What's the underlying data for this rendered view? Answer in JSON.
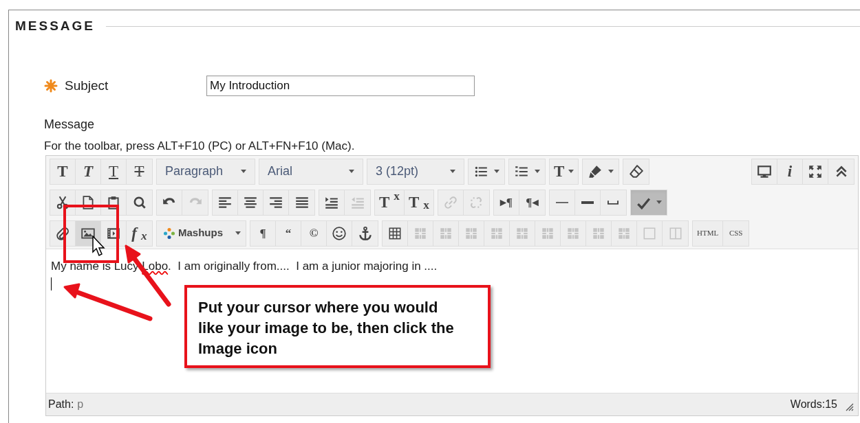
{
  "section": {
    "title": "MESSAGE"
  },
  "subject": {
    "label": "Subject",
    "required": true,
    "value": "My Introduction"
  },
  "message": {
    "label": "Message",
    "hint": "For the toolbar, press ALT+F10 (PC) or ALT+FN+F10 (Mac)."
  },
  "toolbar": {
    "rows": [
      {
        "groups": [
          {
            "buttons": [
              {
                "kind": "bold",
                "label": "T",
                "disabled": false,
                "pressed": false,
                "hovered": false
              },
              {
                "kind": "italic",
                "label": "T",
                "disabled": false,
                "pressed": false,
                "hovered": false
              },
              {
                "kind": "underline",
                "label": "T",
                "disabled": false,
                "pressed": false,
                "hovered": false
              },
              {
                "kind": "strike",
                "label": "T",
                "disabled": false,
                "pressed": false,
                "hovered": false
              }
            ]
          },
          {
            "buttons": [
              {
                "kind": "select",
                "label": "Paragraph",
                "disabled": false,
                "pressed": false,
                "hovered": false
              }
            ]
          },
          {
            "buttons": [
              {
                "kind": "select",
                "label": "Arial",
                "disabled": false,
                "pressed": false,
                "hovered": false
              }
            ]
          },
          {
            "buttons": [
              {
                "kind": "select",
                "label": "3 (12pt)",
                "disabled": false,
                "pressed": false,
                "hovered": false
              }
            ]
          },
          {
            "buttons": [
              {
                "kind": "split",
                "disabled": false,
                "pressed": false,
                "hovered": false
              }
            ]
          },
          {
            "buttons": [
              {
                "kind": "split",
                "disabled": false,
                "pressed": false,
                "hovered": false
              }
            ]
          },
          {
            "buttons": [
              {
                "kind": "splitglyph",
                "label": "T",
                "disabled": false,
                "pressed": false,
                "hovered": false
              }
            ]
          },
          {
            "buttons": [
              {
                "kind": "split",
                "disabled": false,
                "pressed": false,
                "hovered": false
              }
            ]
          },
          {
            "buttons": [
              {
                "kind": "icon",
                "disabled": false,
                "pressed": false,
                "hovered": false
              }
            ]
          }
        ],
        "right_groups": [
          {
            "buttons": [
              {
                "kind": "icon",
                "disabled": false,
                "pressed": false,
                "hovered": false
              },
              {
                "kind": "italic",
                "label": "i",
                "disabled": false,
                "pressed": false,
                "hovered": false
              },
              {
                "kind": "icon",
                "disabled": false,
                "pressed": false,
                "hovered": false
              },
              {
                "kind": "icon",
                "disabled": false,
                "pressed": false,
                "hovered": false
              }
            ]
          }
        ]
      },
      {
        "groups": [
          {
            "buttons": [
              {
                "kind": "icon",
                "disabled": false,
                "pressed": false,
                "hovered": false
              },
              {
                "kind": "icon",
                "disabled": false,
                "pressed": false,
                "hovered": false
              },
              {
                "kind": "icon",
                "disabled": false,
                "pressed": false,
                "hovered": false
              },
              {
                "kind": "icon",
                "disabled": false,
                "pressed": false,
                "hovered": false
              }
            ]
          },
          {
            "buttons": [
              {
                "kind": "icon",
                "disabled": false,
                "pressed": false,
                "hovered": false
              },
              {
                "kind": "icon",
                "disabled": true,
                "pressed": false,
                "hovered": false
              }
            ]
          },
          {
            "buttons": [
              {
                "kind": "icon",
                "disabled": false,
                "pressed": false,
                "hovered": false
              },
              {
                "kind": "icon",
                "disabled": false,
                "pressed": false,
                "hovered": false
              },
              {
                "kind": "icon",
                "disabled": false,
                "pressed": false,
                "hovered": false
              },
              {
                "kind": "icon",
                "disabled": false,
                "pressed": false,
                "hovered": false
              }
            ]
          },
          {
            "buttons": [
              {
                "kind": "icon",
                "disabled": false,
                "pressed": false,
                "hovered": false
              },
              {
                "kind": "icon",
                "disabled": true,
                "pressed": false,
                "hovered": false
              }
            ]
          },
          {
            "buttons": [
              {
                "kind": "bold",
                "label": "T$^{x}$",
                "disabled": false,
                "pressed": false,
                "hovered": false
              },
              {
                "kind": "bold",
                "label": "T$_{x}$",
                "disabled": false,
                "pressed": false,
                "hovered": false
              }
            ]
          },
          {
            "buttons": [
              {
                "kind": "icon",
                "disabled": true,
                "pressed": false,
                "hovered": false
              },
              {
                "kind": "icon",
                "disabled": true,
                "pressed": false,
                "hovered": false
              }
            ]
          },
          {
            "buttons": [
              {
                "kind": "small",
                "label": "▸¶",
                "disabled": false,
                "pressed": false,
                "hovered": false
              },
              {
                "kind": "small",
                "label": "¶◂",
                "disabled": false,
                "pressed": false,
                "hovered": false
              }
            ]
          },
          {
            "buttons": [
              {
                "kind": "icon",
                "disabled": false,
                "pressed": false,
                "hovered": false
              },
              {
                "kind": "icon",
                "disabled": false,
                "pressed": false,
                "hovered": false
              },
              {
                "kind": "icon",
                "disabled": false,
                "pressed": false,
                "hovered": false
              }
            ]
          },
          {
            "buttons": [
              {
                "kind": "split",
                "disabled": false,
                "pressed": true,
                "hovered": false
              }
            ]
          }
        ]
      },
      {
        "groups": [
          {
            "buttons": [
              {
                "kind": "icon",
                "disabled": false,
                "pressed": false,
                "hovered": false
              },
              {
                "kind": "icon",
                "disabled": false,
                "pressed": false,
                "hovered": true
              },
              {
                "kind": "icon",
                "disabled": false,
                "pressed": false,
                "hovered": false
              },
              {
                "kind": "italic",
                "label": "f$_{x}$",
                "disabled": false,
                "pressed": false,
                "hovered": false
              }
            ]
          },
          {
            "buttons": [
              {
                "kind": "menu",
                "label": "Mashups",
                "disabled": false,
                "pressed": false,
                "hovered": false
              }
            ]
          },
          {
            "buttons": [
              {
                "kind": "small",
                "label": "¶",
                "disabled": false,
                "pressed": false,
                "hovered": false
              },
              {
                "kind": "small",
                "label": "“",
                "disabled": false,
                "pressed": false,
                "hovered": false
              },
              {
                "kind": "small",
                "label": "©",
                "disabled": false,
                "pressed": false,
                "hovered": false
              },
              {
                "kind": "icon",
                "disabled": false,
                "pressed": false,
                "hovered": false
              },
              {
                "kind": "icon",
                "disabled": false,
                "pressed": false,
                "hovered": false
              }
            ]
          },
          {
            "buttons": [
              {
                "kind": "icon",
                "disabled": false,
                "pressed": false,
                "hovered": false
              },
              {
                "kind": "icon",
                "disabled": true,
                "pressed": false,
                "hovered": false
              },
              {
                "kind": "icon",
                "disabled": true,
                "pressed": false,
                "hovered": false
              },
              {
                "kind": "icon",
                "disabled": true,
                "pressed": false,
                "hovered": false
              },
              {
                "kind": "icon",
                "disabled": true,
                "pressed": false,
                "hovered": false
              },
              {
                "kind": "icon",
                "disabled": true,
                "pressed": false,
                "hovered": false
              },
              {
                "kind": "icon",
                "disabled": true,
                "pressed": false,
                "hovered": false
              },
              {
                "kind": "icon",
                "disabled": true,
                "pressed": false,
                "hovered": false
              },
              {
                "kind": "icon",
                "disabled": true,
                "pressed": false,
                "hovered": false
              },
              {
                "kind": "icon",
                "disabled": true,
                "pressed": false,
                "hovered": false
              },
              {
                "kind": "icon",
                "disabled": true,
                "pressed": false,
                "hovered": false
              },
              {
                "kind": "icon",
                "disabled": true,
                "pressed": false,
                "hovered": false
              }
            ]
          },
          {
            "buttons": [
              {
                "kind": "code",
                "label": "HTML",
                "disabled": false,
                "pressed": false,
                "hovered": false
              },
              {
                "kind": "code",
                "label": "CSS",
                "disabled": false,
                "pressed": false,
                "hovered": false
              }
            ]
          }
        ]
      }
    ]
  },
  "content": {
    "segments": [
      {
        "text": "My name is Lucy ",
        "misspelled": false
      },
      {
        "text": "Lobo",
        "misspelled": true
      },
      {
        "text": ".  I am originally from....  I am a junior majoring in ....",
        "misspelled": false
      }
    ],
    "caret": true
  },
  "status_bar": {
    "path_label": "Path:",
    "path": "p",
    "words": "Words:15"
  },
  "annotation": {
    "callout": "Put your cursor where you would like your image to be, then click the Image icon"
  }
}
